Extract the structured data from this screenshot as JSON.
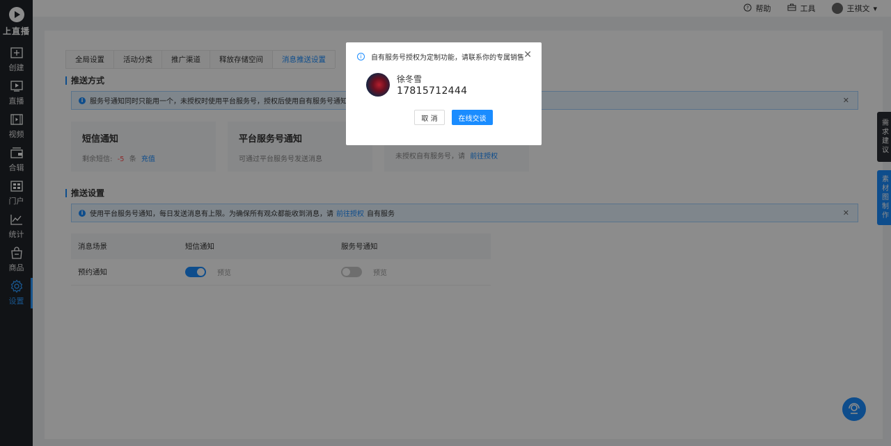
{
  "app": {
    "name": "上直播"
  },
  "sidebar": {
    "items": [
      {
        "label": "创建",
        "icon": "plus-square-icon"
      },
      {
        "label": "直播",
        "icon": "live-play-icon"
      },
      {
        "label": "视频",
        "icon": "video-icon"
      },
      {
        "label": "合辑",
        "icon": "collection-icon"
      },
      {
        "label": "门户",
        "icon": "portal-icon"
      },
      {
        "label": "统计",
        "icon": "chart-line-icon"
      },
      {
        "label": "商品",
        "icon": "shopping-bag-icon"
      },
      {
        "label": "设置",
        "icon": "gear-icon",
        "active": true
      }
    ]
  },
  "topbar": {
    "help": "帮助",
    "tools": "工具",
    "user": "王祺文"
  },
  "tabs": [
    "全局设置",
    "活动分类",
    "推广渠道",
    "释放存储空间",
    "消息推送设置"
  ],
  "active_tab": "消息推送设置",
  "push_method": {
    "title": "推送方式",
    "notice": "服务号通知同时只能用一个，未授权时使用平台服务号，授权后使用自有服务号通知",
    "cards": [
      {
        "title": "短信通知",
        "desc_prefix": "剩余短信:",
        "count": "-5",
        "unit": "条",
        "link": "充值"
      },
      {
        "title": "平台服务号通知",
        "desc": "可通过平台服务号发送消息"
      },
      {
        "desc": "未授权自有服务号，请",
        "link": "前往授权"
      }
    ]
  },
  "push_settings": {
    "title": "推送设置",
    "notice_prefix": "使用平台服务号通知，每日发送消息有上限。为确保所有观众都能收到消息，请",
    "notice_link": "前往授权",
    "notice_suffix": "自有服务",
    "columns": [
      "消息场景",
      "短信通知",
      "服务号通知"
    ],
    "rows": [
      {
        "scene": "预约通知",
        "sms_on": true,
        "sms_preview": "预览",
        "service_on": false,
        "service_preview": "预览"
      }
    ]
  },
  "float_tabs": [
    "需求建议",
    "素材图制作"
  ],
  "modal": {
    "message": "自有服务号授权为定制功能，请联系你的专属销售",
    "contact_name": "徐冬雪",
    "contact_phone": "17815712444",
    "cancel": "取 消",
    "confirm": "在线交谈"
  },
  "colors": {
    "accent": "#1a8cff",
    "sidebar": "#1f2329",
    "danger": "#ff4d4f"
  }
}
